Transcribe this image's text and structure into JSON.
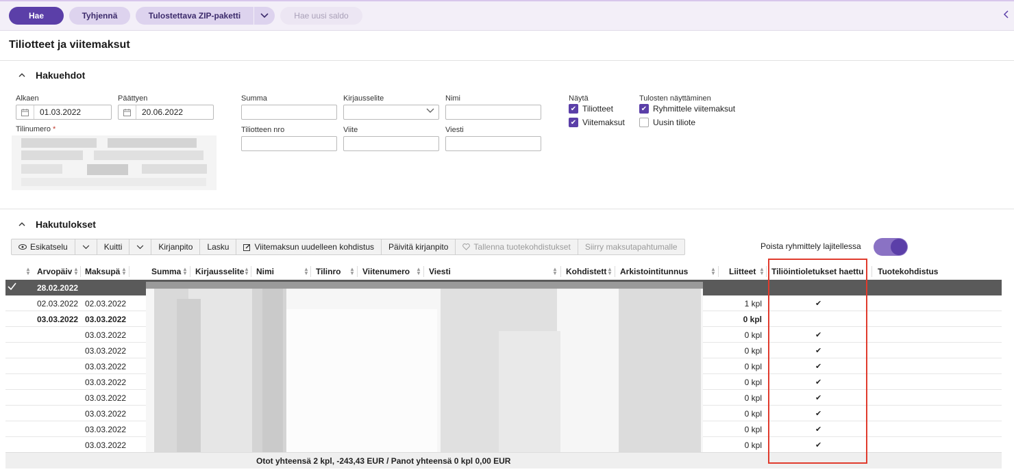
{
  "toolbar": {
    "search_label": "Hae",
    "clear_label": "Tyhjennä",
    "zip_label": "Tulostettava ZIP-paketti",
    "new_balance_label": "Hae uusi saldo"
  },
  "page": {
    "title": "Tiliotteet ja viitemaksut"
  },
  "criteria": {
    "title": "Hakuehdot",
    "start_label": "Alkaen",
    "start_value": "01.03.2022",
    "end_label": "Päättyen",
    "end_value": "20.06.2022",
    "account_label": "Tilinumero",
    "required_mark": "*",
    "sum_label": "Summa",
    "entry_label": "Kirjausselite",
    "name_label": "Nimi",
    "statement_no_label": "Tiliotteen nro",
    "reference_label": "Viite",
    "message_label": "Viesti",
    "show_label": "Näytä",
    "show_statements": "Tiliotteet",
    "show_refpayments": "Viitemaksut",
    "results_display_label": "Tulosten näyttäminen",
    "group_refpayments": "Ryhmittele viitemaksut",
    "latest_statement": "Uusin tiliote"
  },
  "results": {
    "title": "Hakutulokset",
    "actions": {
      "preview": "Esikatselu",
      "receipt": "Kuitti",
      "bookkeeping": "Kirjanpito",
      "invoice": "Lasku",
      "reallocate": "Viitemaksun uudelleen kohdistus",
      "update_bookkeeping": "Päivitä kirjanpito",
      "save_allocations": "Tallenna tuotekohdistukset",
      "go_to_event": "Siirry maksutapahtumalle"
    },
    "toggle_label": "Poista ryhmittely lajitellessa",
    "columns": {
      "value_date": "Arvopäiv",
      "payment_date": "Maksupä",
      "sum": "Summa",
      "entry": "Kirjausselite",
      "name": "Nimi",
      "account": "Tilinro",
      "reference": "Viitenumero",
      "message": "Viesti",
      "allocated": "Kohdistett",
      "archive_id": "Arkistointitunnus",
      "attachments": "Liitteet",
      "fetched": "Tiliöintioletukset haettu",
      "product_alloc": "Tuotekohdistus"
    },
    "group_date": "28.02.2022",
    "rows": [
      {
        "value_date": "02.03.2022",
        "payment_date": "02.03.2022",
        "attachments": "1 kpl",
        "fetched": "✔",
        "bold": false
      },
      {
        "value_date": "03.03.2022",
        "payment_date": "03.03.2022",
        "attachments": "0 kpl",
        "fetched": "",
        "bold": true
      },
      {
        "value_date": "",
        "payment_date": "03.03.2022",
        "attachments": "0 kpl",
        "fetched": "✔",
        "bold": false
      },
      {
        "value_date": "",
        "payment_date": "03.03.2022",
        "attachments": "0 kpl",
        "fetched": "✔",
        "bold": false
      },
      {
        "value_date": "",
        "payment_date": "03.03.2022",
        "attachments": "0 kpl",
        "fetched": "✔",
        "bold": false
      },
      {
        "value_date": "",
        "payment_date": "03.03.2022",
        "attachments": "0 kpl",
        "fetched": "✔",
        "bold": false
      },
      {
        "value_date": "",
        "payment_date": "03.03.2022",
        "attachments": "0 kpl",
        "fetched": "✔",
        "bold": false
      },
      {
        "value_date": "",
        "payment_date": "03.03.2022",
        "attachments": "0 kpl",
        "fetched": "✔",
        "bold": false
      },
      {
        "value_date": "",
        "payment_date": "03.03.2022",
        "attachments": "0 kpl",
        "fetched": "✔",
        "bold": false
      },
      {
        "value_date": "",
        "payment_date": "03.03.2022",
        "attachments": "0 kpl",
        "fetched": "✔",
        "bold": false
      }
    ],
    "footer": "Otot yhteensä 2 kpl, -243,43 EUR / Panot yhteensä 0 kpl 0,00 EUR"
  },
  "colors": {
    "accent": "#5b3fa8",
    "highlight": "#e03a2c"
  }
}
